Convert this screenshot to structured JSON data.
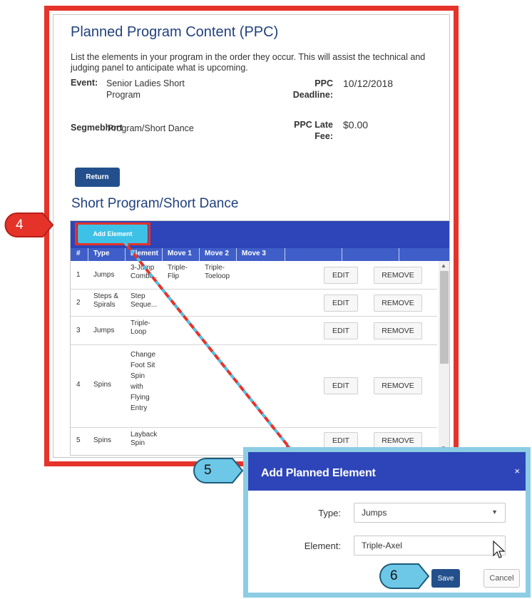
{
  "ppc": {
    "title": "Planned Program Content (PPC)",
    "intro": "List the elements in your program in the order they occur. This will assist the technical and judging panel to anticipate what is upcoming.",
    "event_label": "Event:",
    "event_value": "Senior Ladies Short Program",
    "segment_label": "Segmebhort",
    "segment_value": "Program/Short Dance",
    "deadline_label": "PPC Deadline:",
    "deadline_value": "10/12/2018",
    "late_fee_label": "PPC Late Fee:",
    "late_fee_value": "$0.00",
    "return_label": "Return",
    "section_title": "Short Program/Short Dance",
    "add_element_label": "Add Element"
  },
  "table": {
    "columns": [
      "#",
      "Type",
      "Element",
      "Move 1",
      "Move 2",
      "Move 3"
    ],
    "edit_label": "EDIT",
    "remove_label": "REMOVE",
    "rows": [
      {
        "num": "1",
        "type": "Jumps",
        "element": "3-Jump Combi...",
        "move1": "Triple-Flip",
        "move2": "Triple-Toeloop",
        "move3": ""
      },
      {
        "num": "2",
        "type": "Steps & Spirals",
        "element": "Step Seque...",
        "move1": "",
        "move2": "",
        "move3": ""
      },
      {
        "num": "3",
        "type": "Jumps",
        "element": "Triple-Loop",
        "move1": "",
        "move2": "",
        "move3": ""
      },
      {
        "num": "4",
        "type": "Spins",
        "element": "Change Foot Sit Spin with Flying Entry",
        "move1": "",
        "move2": "",
        "move3": ""
      },
      {
        "num": "5",
        "type": "Spins",
        "element": "Layback Spin",
        "move1": "",
        "move2": "",
        "move3": ""
      }
    ]
  },
  "callouts": {
    "step4": "4",
    "step5": "5",
    "step6": "6"
  },
  "dialog": {
    "title": "Add Planned Element",
    "close": "×",
    "type_label": "Type:",
    "type_value": "Jumps",
    "element_label": "Element:",
    "element_value": "Triple-Axel",
    "save_label": "Save",
    "cancel_label": "Cancel"
  },
  "colors": {
    "frame_red": "#e5332a",
    "dialog_frame": "#8ccde4",
    "header_blue": "#2d45b8",
    "title_navy": "#21417e",
    "button_navy": "#23508c",
    "add_button_cyan": "#3ec1e6"
  }
}
